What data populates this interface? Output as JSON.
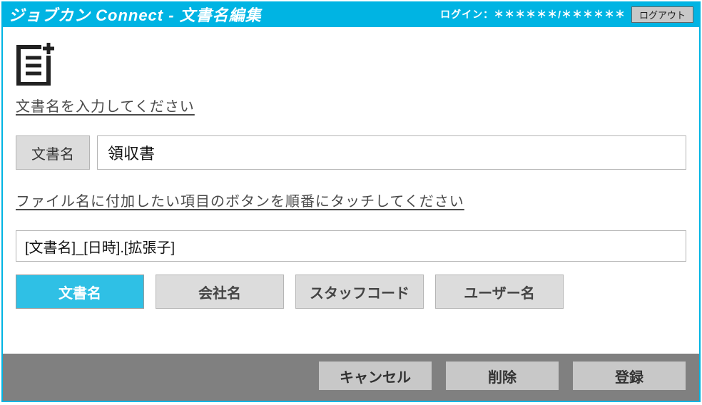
{
  "header": {
    "title": "ジョブカン Connect - 文書名編集",
    "login_label": "ログイン：＊＊＊＊＊＊/＊＊＊＊＊＊",
    "logout_label": "ログアウト"
  },
  "main": {
    "instruction1": "文書名を入力してください",
    "doc_name_label": "文書名",
    "doc_name_value": "領収書",
    "instruction2": "ファイル名に付加したい項目のボタンを順番にタッチしてください",
    "pattern_value": "[文書名]_[日時].[拡張子]",
    "tag_buttons": [
      {
        "label": "文書名",
        "active": true
      },
      {
        "label": "会社名",
        "active": false
      },
      {
        "label": "スタッフコード",
        "active": false
      },
      {
        "label": "ユーザー名",
        "active": false
      }
    ]
  },
  "footer": {
    "cancel": "キャンセル",
    "delete": "削除",
    "register": "登録"
  }
}
